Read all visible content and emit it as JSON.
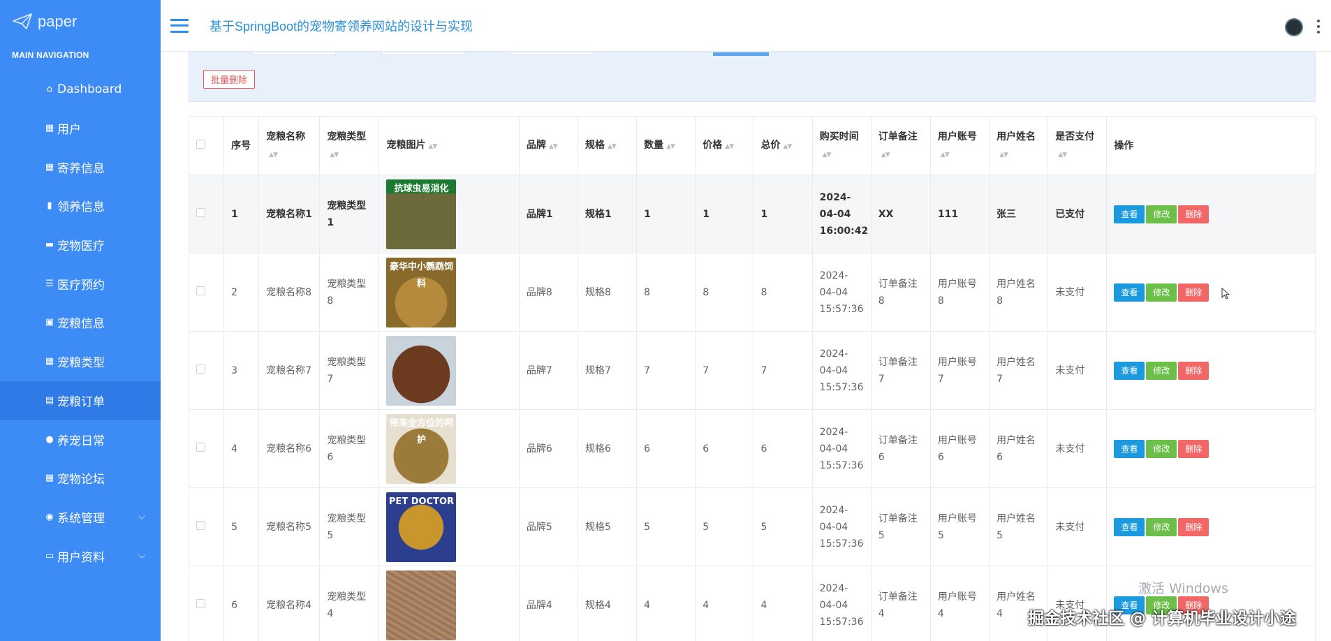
{
  "app": {
    "logo_text": "paper",
    "title": "基于SpringBoot的宠物寄领养网站的设计与实现"
  },
  "sidebar": {
    "heading": "MAIN NAVIGATION",
    "items": [
      {
        "label": "Dashboard",
        "icon": "home-icon"
      },
      {
        "label": "用户",
        "icon": "grid-icon"
      },
      {
        "label": "寄养信息",
        "icon": "grid-icon"
      },
      {
        "label": "领养信息",
        "icon": "bar-chart-icon"
      },
      {
        "label": "宠物医疗",
        "icon": "briefcase-icon"
      },
      {
        "label": "医疗预约",
        "icon": "list-icon"
      },
      {
        "label": "宠粮信息",
        "icon": "image-icon"
      },
      {
        "label": "宠粮类型",
        "icon": "grid-icon"
      },
      {
        "label": "宠粮订单",
        "icon": "document-icon",
        "active": true
      },
      {
        "label": "养宠日常",
        "icon": "bulb-icon"
      },
      {
        "label": "宠物论坛",
        "icon": "grid-icon"
      },
      {
        "label": "系统管理",
        "icon": "user-icon",
        "expandable": true
      },
      {
        "label": "用户资料",
        "icon": "calendar-icon",
        "expandable": true
      }
    ]
  },
  "toolbar": {
    "batch_delete_label": "批量删除"
  },
  "table": {
    "columns": [
      "序号",
      "宠粮名称",
      "宠粮类型",
      "宠粮图片",
      "品牌",
      "规格",
      "数量",
      "价格",
      "总价",
      "购买时间",
      "订单备注",
      "用户账号",
      "用户姓名",
      "是否支付",
      "操作"
    ],
    "rows": [
      {
        "no": "1",
        "name": "宠粮名称1",
        "type": "宠粮类型1",
        "image_caption": "抗球虫易消化",
        "brand": "品牌1",
        "spec": "规格1",
        "qty": "1",
        "price": "1",
        "total": "1",
        "time": "2024-04-04 16:00:42",
        "remark": "XX",
        "account": "111",
        "username": "张三",
        "paid": "已支付",
        "highlight": true
      },
      {
        "no": "2",
        "name": "宠粮名称8",
        "type": "宠粮类型8",
        "image_caption": "豪华中小鹦鹉饲料",
        "brand": "品牌8",
        "spec": "规格8",
        "qty": "8",
        "price": "8",
        "total": "8",
        "time": "2024-04-04 15:57:36",
        "remark": "订单备注8",
        "account": "用户账号8",
        "username": "用户姓名8",
        "paid": "未支付"
      },
      {
        "no": "3",
        "name": "宠粮名称7",
        "type": "宠粮类型7",
        "image_caption": "",
        "brand": "品牌7",
        "spec": "规格7",
        "qty": "7",
        "price": "7",
        "total": "7",
        "time": "2024-04-04 15:57:36",
        "remark": "订单备注7",
        "account": "用户账号7",
        "username": "用户姓名7",
        "paid": "未支付"
      },
      {
        "no": "4",
        "name": "宠粮名称6",
        "type": "宠粮类型6",
        "image_caption": "带来全方位的呵护",
        "brand": "品牌6",
        "spec": "规格6",
        "qty": "6",
        "price": "6",
        "total": "6",
        "time": "2024-04-04 15:57:36",
        "remark": "订单备注6",
        "account": "用户账号6",
        "username": "用户姓名6",
        "paid": "未支付"
      },
      {
        "no": "5",
        "name": "宠粮名称5",
        "type": "宠粮类型5",
        "image_caption": "PET DOCTOR",
        "brand": "品牌5",
        "spec": "规格5",
        "qty": "5",
        "price": "5",
        "total": "5",
        "time": "2024-04-04 15:57:36",
        "remark": "订单备注5",
        "account": "用户账号5",
        "username": "用户姓名5",
        "paid": "未支付"
      },
      {
        "no": "6",
        "name": "宠粮名称4",
        "type": "宠粮类型4",
        "image_caption": "",
        "brand": "品牌4",
        "spec": "规格4",
        "qty": "4",
        "price": "4",
        "total": "4",
        "time": "2024-04-04 15:57:36",
        "remark": "订单备注4",
        "account": "用户账号4",
        "username": "用户姓名4",
        "paid": "未支付"
      }
    ],
    "actions": {
      "view": "查看",
      "edit": "修改",
      "delete": "删除"
    }
  },
  "overlays": {
    "windows_activation": "激活 Windows",
    "juejin_watermark": "掘金技术社区 @ 计算机毕业设计小途"
  },
  "colors": {
    "sidebar_bg": "#3d8bf5",
    "sidebar_active": "#2f7ae6",
    "view_button": "#1c9ae0",
    "edit_button": "#6cc04a",
    "delete_button": "#f26666",
    "title_text": "#2a8fd6"
  }
}
